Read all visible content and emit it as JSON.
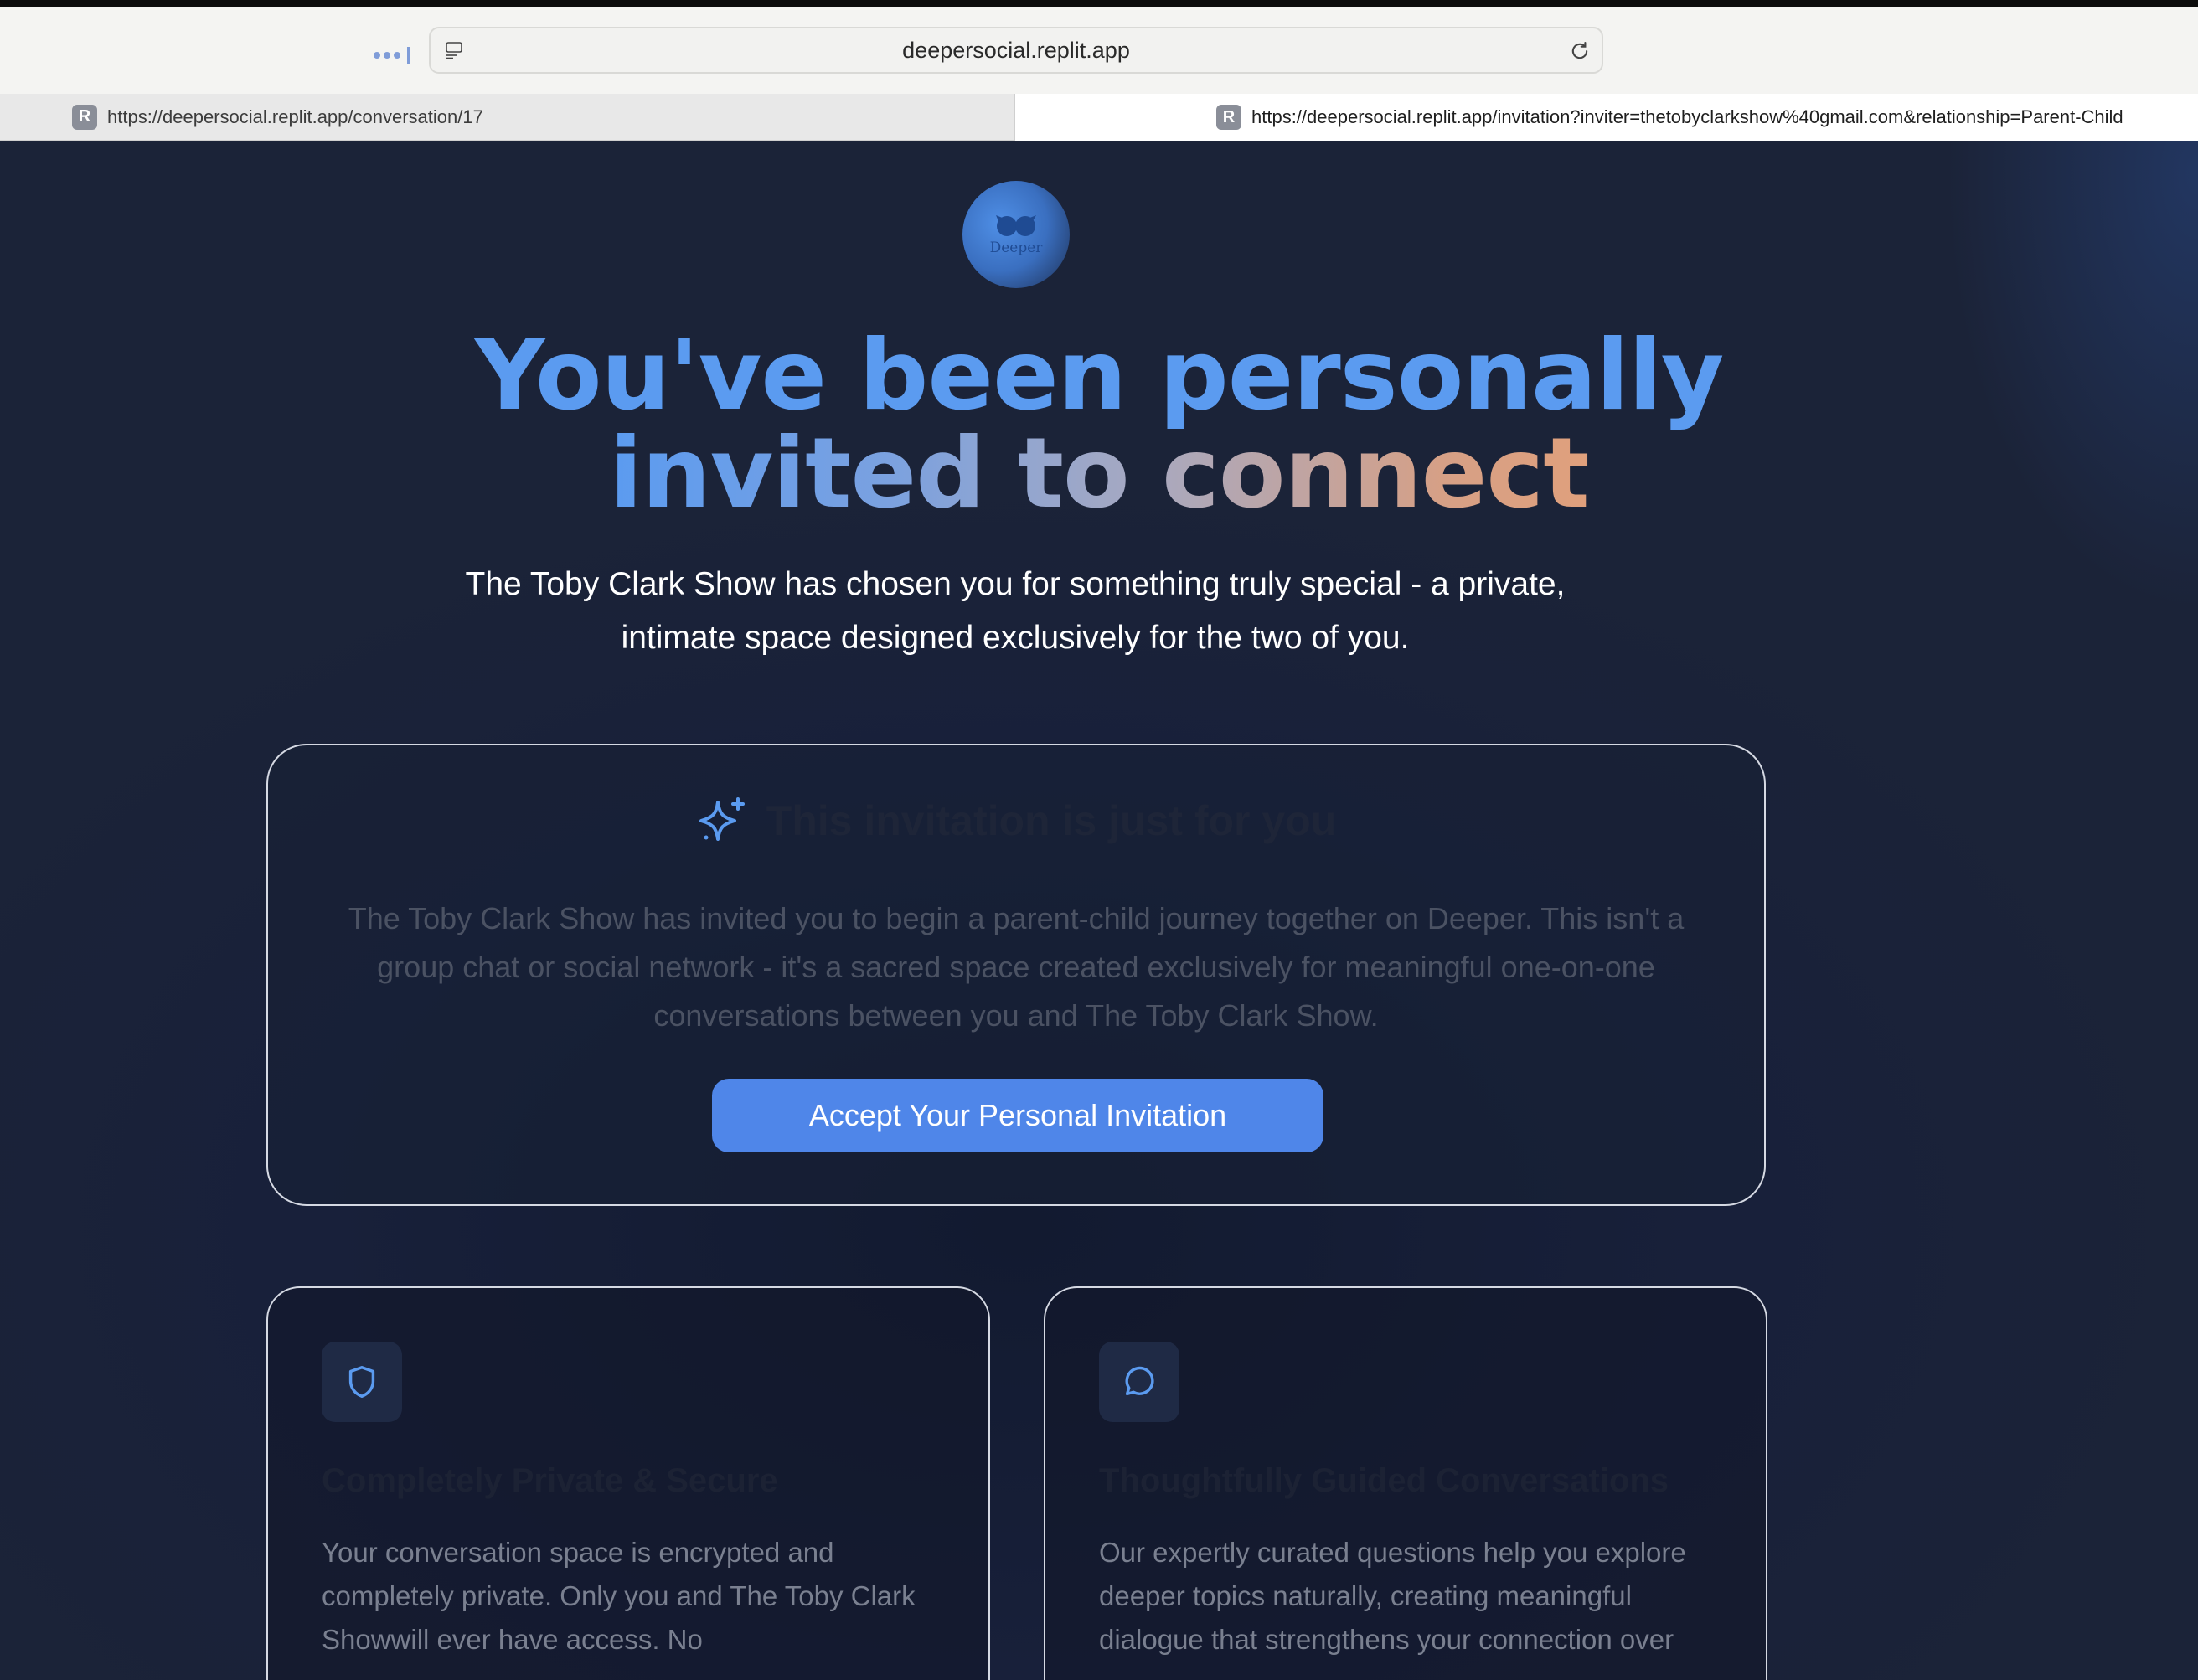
{
  "browser": {
    "address": "deepersocial.replit.app",
    "tabs": [
      {
        "favicon": "R",
        "url": "https://deepersocial.replit.app/conversation/17"
      },
      {
        "favicon": "R",
        "url": "https://deepersocial.replit.app/invitation?inviter=thetobyclarkshow%40gmail.com&relationship=Parent-Child"
      }
    ]
  },
  "logo": {
    "text": "Deeper"
  },
  "hero": {
    "line1": "You've been personally",
    "line2": "invited to connect",
    "subtitle": "The Toby Clark Show has chosen you for something truly special - a private, intimate space designed exclusively for the two of you."
  },
  "invitation": {
    "title": "This invitation is just for you",
    "body": "The Toby Clark Show has invited you to begin a parent-child journey together on Deeper. This isn't a group chat or social network - it's a sacred space created exclusively for meaningful one-on-one conversations between you and The Toby Clark Show.",
    "button": "Accept Your Personal Invitation"
  },
  "features": [
    {
      "icon": "shield-icon",
      "title": "Completely Private & Secure",
      "body": "Your conversation space is encrypted and completely private. Only you and The Toby Clark Showwill ever have access. No"
    },
    {
      "icon": "chat-bubble-icon",
      "title": "Thoughtfully Guided Conversations",
      "body": "Our expertly curated questions help you explore deeper topics naturally, creating meaningful dialogue that strengthens your connection over"
    }
  ],
  "colors": {
    "accent": "#4f86e9",
    "heading_blue": "#5b9bf0",
    "heading_peach": "#e0a07c",
    "page_bg": "#1a2236"
  }
}
